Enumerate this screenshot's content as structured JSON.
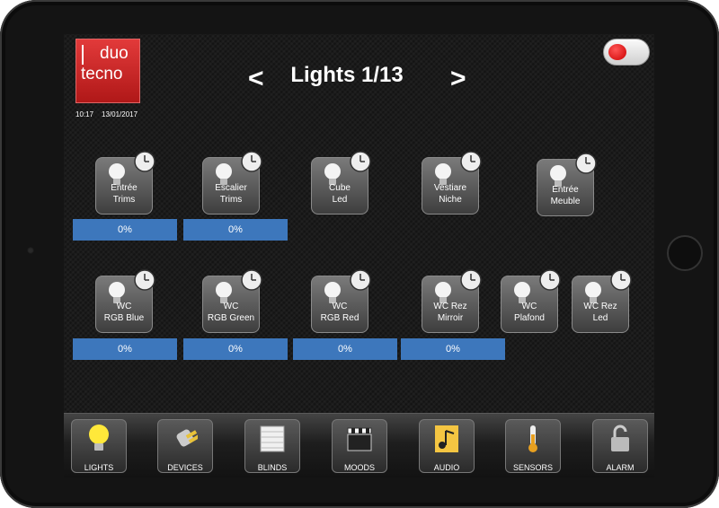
{
  "header": {
    "logo_text_1": "duo",
    "logo_text_2": "tecno",
    "time": "10:17",
    "date": "13/01/2017",
    "title": "Lights 1/13",
    "prev_symbol": "<",
    "next_symbol": ">"
  },
  "lights": [
    {
      "line1": "Entrée",
      "line2": "Trims",
      "level": "0%"
    },
    {
      "line1": "Escalier",
      "line2": "Trims",
      "level": "0%"
    },
    {
      "line1": "Cube",
      "line2": "Led"
    },
    {
      "line1": "Vestiare",
      "line2": "Niche"
    },
    {
      "line1": "Entrée",
      "line2": "Meuble"
    },
    {
      "line1": "WC",
      "line2": "RGB Blue",
      "level": "0%"
    },
    {
      "line1": "WC",
      "line2": "RGB Green",
      "level": "0%"
    },
    {
      "line1": "WC",
      "line2": "RGB Red",
      "level": "0%"
    },
    {
      "line1": "WC Rez",
      "line2": "Mirroir",
      "level": "0%"
    },
    {
      "line1": "WC",
      "line2": "Plafond"
    },
    {
      "line1": "WC Rez",
      "line2": "Led"
    }
  ],
  "nav": [
    {
      "label": "LIGHTS",
      "icon": "bulb-icon"
    },
    {
      "label": "DEVICES",
      "icon": "plug-icon"
    },
    {
      "label": "BLINDS",
      "icon": "blinds-icon"
    },
    {
      "label": "MOODS",
      "icon": "clapperboard-icon"
    },
    {
      "label": "AUDIO",
      "icon": "music-note-icon"
    },
    {
      "label": "SENSORS",
      "icon": "thermometer-icon"
    },
    {
      "label": "ALARM",
      "icon": "padlock-icon"
    }
  ],
  "colors": {
    "level_bar": "#3d77bc",
    "logo_red": "#d42a2a",
    "record": "#cc0000"
  }
}
